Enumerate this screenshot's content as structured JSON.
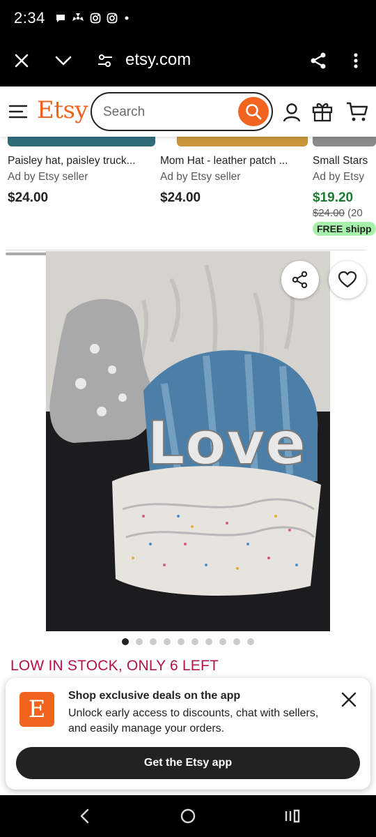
{
  "status_bar": {
    "time": "2:34"
  },
  "browser": {
    "url": "etsy.com"
  },
  "header": {
    "logo": "Etsy",
    "search_placeholder": "Search"
  },
  "cards": [
    {
      "title": "Paisley hat, paisley truck...",
      "ad": "Ad by Etsy seller",
      "price": "$24.00"
    },
    {
      "title": "Mom Hat - leather patch ...",
      "ad": "Ad by Etsy seller",
      "price": "$24.00"
    },
    {
      "title": "Small Stars",
      "ad": "Ad by Etsy",
      "price": "$19.20",
      "old_price": "$24.00",
      "old_price_suffix": "(20",
      "badge": "FREE shipp"
    }
  ],
  "gallery": {
    "image_count": 10,
    "active_index": 0
  },
  "stock_text": "LOW IN STOCK, ONLY 6 LEFT",
  "app_banner": {
    "logo_letter": "E",
    "title": "Shop exclusive deals on the app",
    "description": "Unlock early access to discounts, chat with sellers, and easily manage your orders.",
    "button": "Get the Etsy app"
  },
  "colors": {
    "brand": "#F1641E",
    "stock": "#b3124a",
    "sale": "#1e7a33",
    "free_badge": "#a7f0ab"
  }
}
